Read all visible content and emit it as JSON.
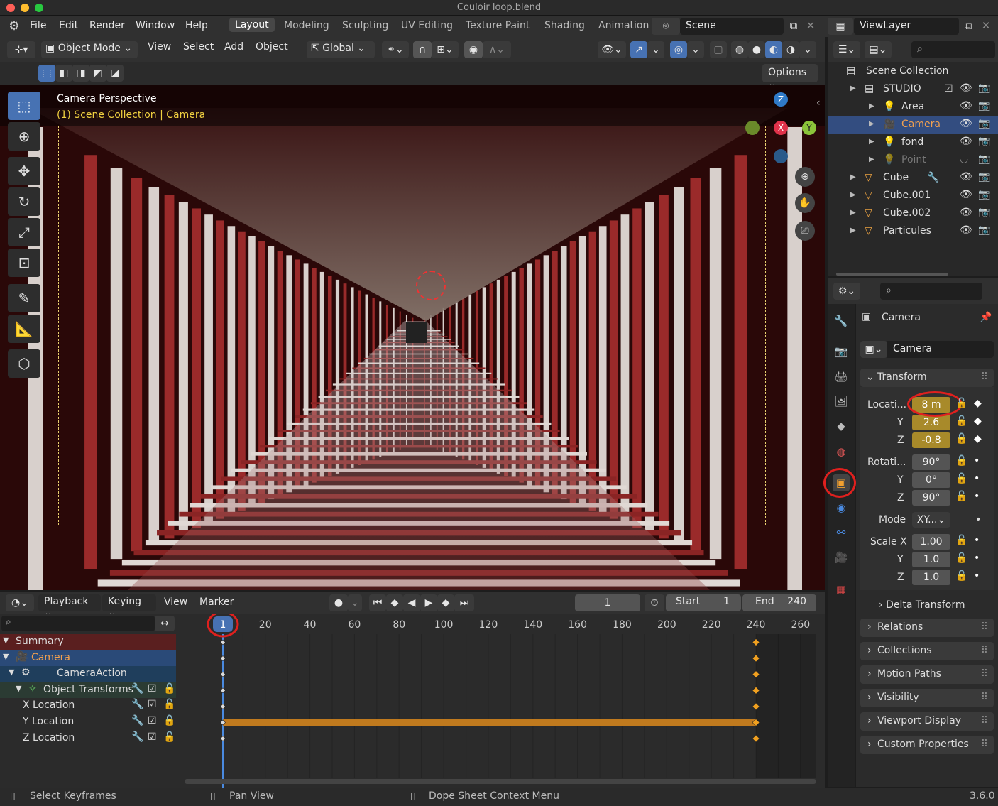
{
  "window": {
    "title": "Couloir loop.blend",
    "version": "3.6.0"
  },
  "menu": [
    "File",
    "Edit",
    "Render",
    "Window",
    "Help"
  ],
  "workspaces": [
    "Layout",
    "Modeling",
    "Sculpting",
    "UV Editing",
    "Texture Paint",
    "Shading",
    "Animation"
  ],
  "active_workspace": "Layout",
  "scene": "Scene",
  "view_layer": "ViewLayer",
  "viewport_header": {
    "mode": "Object Mode",
    "view": "View",
    "select": "Select",
    "add": "Add",
    "object": "Object",
    "orientation": "Global",
    "options": "Options"
  },
  "viewport": {
    "title": "Camera Perspective",
    "subtitle": "(1) Scene Collection | Camera"
  },
  "gizmo": {
    "z": "Z",
    "y": "Y",
    "x": "X"
  },
  "outliner": {
    "root": "Scene Collection",
    "items": [
      {
        "label": "STUDIO",
        "indent": 1,
        "kind": "collection"
      },
      {
        "label": "Area",
        "indent": 2,
        "kind": "light"
      },
      {
        "label": "Camera",
        "indent": 2,
        "kind": "camera",
        "selected": true
      },
      {
        "label": "fond",
        "indent": 2,
        "kind": "light"
      },
      {
        "label": "Point",
        "indent": 2,
        "kind": "light",
        "hidden": true
      },
      {
        "label": "Cube",
        "indent": 1,
        "kind": "mesh"
      },
      {
        "label": "Cube.001",
        "indent": 1,
        "kind": "mesh"
      },
      {
        "label": "Cube.002",
        "indent": 1,
        "kind": "mesh"
      },
      {
        "label": "Particules",
        "indent": 1,
        "kind": "mesh"
      }
    ]
  },
  "properties": {
    "object_name": "Camera",
    "data_name": "Camera",
    "transform_label": "Transform",
    "location_label": "Locati...",
    "location": {
      "x": "8 m",
      "y": "2.6",
      "z": "-0.8"
    },
    "rotation_label": "Rotati...",
    "rotation": {
      "x": "90°",
      "y": "0°",
      "z": "90°"
    },
    "mode_label": "Mode",
    "mode_value": "XY...",
    "scale_label": "Scale X",
    "scale": {
      "x": "1.00",
      "y": "1.0",
      "z": "1.0"
    },
    "axis_y": "Y",
    "axis_z": "Z",
    "delta": "Delta Transform",
    "panels": [
      "Relations",
      "Collections",
      "Motion Paths",
      "Visibility",
      "Viewport Display",
      "Custom Properties"
    ]
  },
  "timeline": {
    "playback": "Playback",
    "keying": "Keying",
    "view": "View",
    "marker": "Marker",
    "current_frame": "1",
    "start_label": "Start",
    "start": "1",
    "end_label": "End",
    "end": "240",
    "ruler": [
      "20",
      "40",
      "60",
      "80",
      "100",
      "120",
      "140",
      "160",
      "180",
      "200",
      "220",
      "240",
      "260"
    ],
    "playhead": "1",
    "channels": [
      {
        "label": "Summary",
        "level": 0
      },
      {
        "label": "Camera",
        "level": 0
      },
      {
        "label": "CameraAction",
        "level": 1
      },
      {
        "label": "Object Transforms",
        "level": 2
      },
      {
        "label": "X Location",
        "level": 3
      },
      {
        "label": "Y Location",
        "level": 3
      },
      {
        "label": "Z Location",
        "level": 3
      }
    ]
  },
  "status": {
    "left": "Select Keyframes",
    "middle": "Pan View",
    "right": "Dope Sheet Context Menu"
  }
}
